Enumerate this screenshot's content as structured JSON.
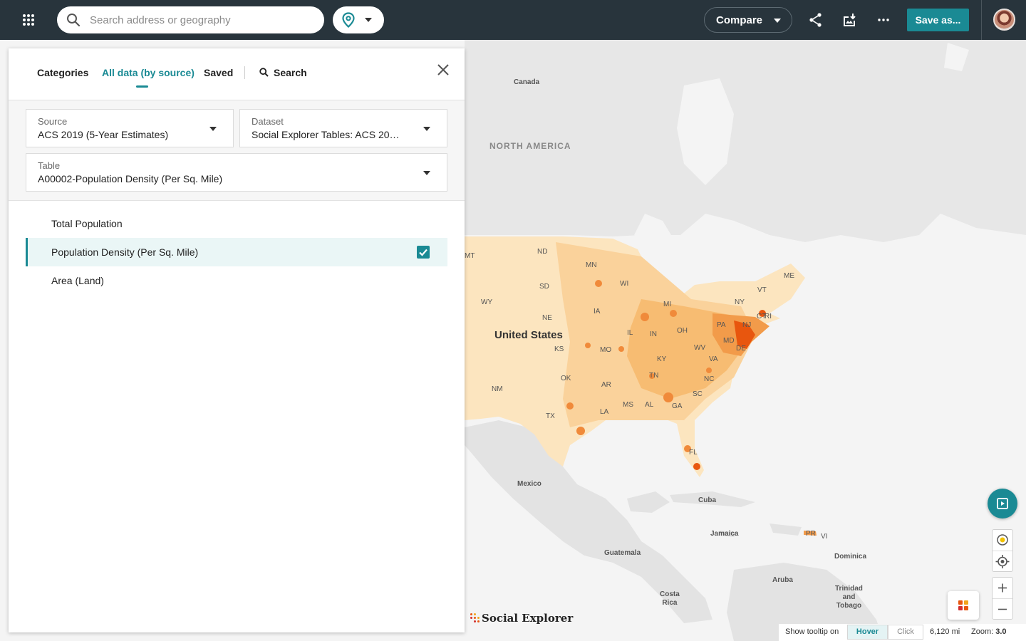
{
  "topbar": {
    "search_placeholder": "Search address or geography",
    "compare_label": "Compare",
    "save_label": "Save as..."
  },
  "panel": {
    "tabs": [
      {
        "label": "Categories",
        "active": false
      },
      {
        "label": "All data (by source)",
        "active": true
      },
      {
        "label": "Saved",
        "active": false
      }
    ],
    "search_tab_label": "Search",
    "source": {
      "label": "Source",
      "value": "ACS 2019 (5-Year Estimates)"
    },
    "dataset": {
      "label": "Dataset",
      "value": "Social Explorer Tables: ACS 20…"
    },
    "table": {
      "label": "Table",
      "value": "A00002-Population Density (Per Sq. Mile)"
    },
    "variables": [
      {
        "label": "Total Population",
        "selected": false
      },
      {
        "label": "Population Density (Per Sq. Mile)",
        "selected": true
      },
      {
        "label": "Area (Land)",
        "selected": false
      }
    ]
  },
  "map": {
    "labels": {
      "canada": "Canada",
      "north_america": "NORTH AMERICA",
      "united_states": "United States",
      "mexico": "Mexico",
      "cuba": "Cuba",
      "jamaica": "Jamaica",
      "guatemala": "Guatemala",
      "dominica": "Dominica",
      "aruba": "Aruba",
      "trinidad": "Trinidad\nand\nTobago",
      "costa_rica": "Costa\nRica",
      "pr": "PR",
      "vi": "VI"
    },
    "states": [
      "MT",
      "ND",
      "MN",
      "WI",
      "SD",
      "WY",
      "NE",
      "IA",
      "MI",
      "NY",
      "VT",
      "ME",
      "CT",
      "RI",
      "PA",
      "NJ",
      "MD",
      "DE",
      "OH",
      "IN",
      "IL",
      "KS",
      "MO",
      "KY",
      "WV",
      "VA",
      "TN",
      "NC",
      "OK",
      "AR",
      "NM",
      "SC",
      "MS",
      "AL",
      "GA",
      "LA",
      "TX",
      "FL"
    ]
  },
  "bottom_bar": {
    "tooltip_label": "Show tooltip on",
    "hover_label": "Hover",
    "click_label": "Click",
    "scale": "6,120 mi",
    "zoom_label": "Zoom:",
    "zoom_value": "3.0"
  },
  "branding": {
    "logo_text": "Social Explorer"
  },
  "colors": {
    "accent": "#1a8a94",
    "topbar": "#28343c",
    "choropleth_low": "#fde9c4",
    "choropleth_high": "#e8560e"
  }
}
